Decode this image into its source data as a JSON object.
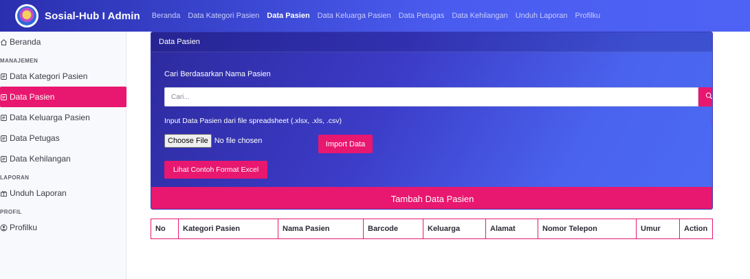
{
  "brand": {
    "name": "Sosial-Hub I Admin"
  },
  "nav": {
    "links": [
      {
        "label": "Beranda",
        "active": false
      },
      {
        "label": "Data Kategori Pasien",
        "active": false
      },
      {
        "label": "Data Pasien",
        "active": true
      },
      {
        "label": "Data Keluarga Pasien",
        "active": false
      },
      {
        "label": "Data Petugas",
        "active": false
      },
      {
        "label": "Data Kehilangan",
        "active": false
      },
      {
        "label": "Unduh Laporan",
        "active": false
      },
      {
        "label": "Profilku",
        "active": false
      }
    ]
  },
  "sidebar": {
    "home": "Beranda",
    "heading_manage": "MANAJEMEN",
    "items": [
      "Data Kategori Pasien",
      "Data Pasien",
      "Data Keluarga Pasien",
      "Data Petugas",
      "Data Kehilangan"
    ],
    "active_item": "Data Pasien",
    "heading_report": "LAPORAN",
    "report_item": "Unduh Laporan",
    "heading_profile": "PROFIL",
    "profile_item": "Profilku"
  },
  "card": {
    "title": "Data Pasien",
    "search_label": "Cari Berdasarkan Nama Pasien",
    "search_placeholder": "Cari...",
    "import_label": "Input Data Pasien dari file spreadsheet (.xlsx, .xls, .csv)",
    "file_button": "Choose File",
    "file_status": "No file chosen",
    "import_button": "Import Data",
    "excel_button": "Lihat Contoh Format Excel",
    "add_button": "Tambah Data Pasien"
  },
  "table": {
    "headers": [
      "No",
      "Kategori Pasien",
      "Nama Pasien",
      "Barcode",
      "Keluarga",
      "Alamat",
      "Nomor Telepon",
      "Umur",
      "Action"
    ]
  },
  "colors": {
    "primary": "#4a5cf0",
    "accent": "#e8176f"
  }
}
